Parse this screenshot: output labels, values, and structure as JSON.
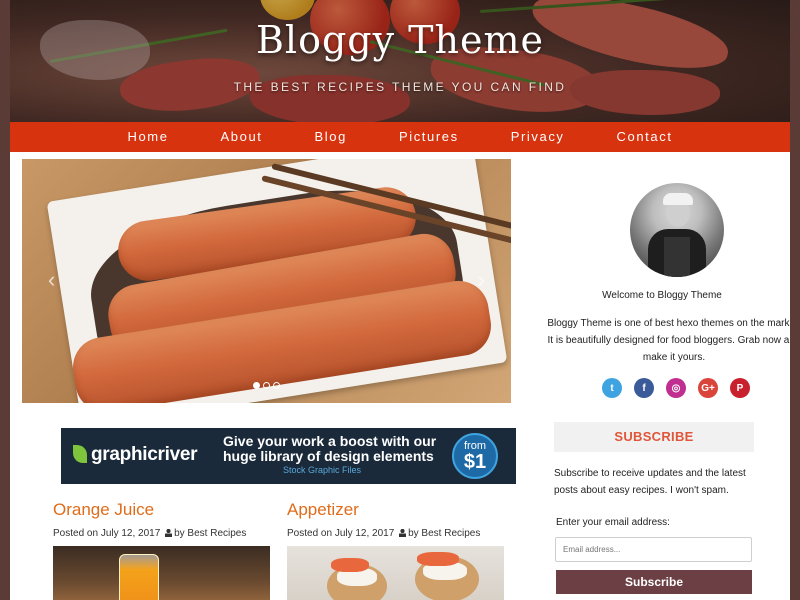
{
  "header": {
    "site_title": "Bloggy Theme",
    "tagline": "THE BEST RECIPES THEME YOU CAN FIND"
  },
  "nav": {
    "items": [
      "Home",
      "About",
      "Blog",
      "Pictures",
      "Privacy",
      "Contact"
    ]
  },
  "slider": {
    "prev_arrow": "‹",
    "next_arrow": "›",
    "dots": 3,
    "active_dot": 0
  },
  "ad_banner": {
    "logo": "graphicriver",
    "headline_line1": "Give your work a boost with our",
    "headline_line2": "huge library of design elements",
    "subline": "Stock Graphic Files",
    "badge_from": "from",
    "badge_price": "$1"
  },
  "posts": [
    {
      "title": "Orange Juice",
      "meta_prefix": "Posted on July 12, 2017",
      "meta_author": "by Best Recipes"
    },
    {
      "title": "Appetizer",
      "meta_prefix": "Posted on July 12, 2017",
      "meta_author": "by Best Recipes"
    }
  ],
  "sidebar": {
    "welcome": "Welcome to Bloggy Theme",
    "about": "Bloggy Theme is one of best hexo themes on the market. It is beautifully designed for food bloggers. Grab now and make it yours.",
    "socials": [
      {
        "name": "twitter-icon",
        "glyph": "t",
        "color": "#3ea3e0"
      },
      {
        "name": "facebook-icon",
        "glyph": "f",
        "color": "#3b5a9a"
      },
      {
        "name": "instagram-icon",
        "glyph": "◎",
        "color": "#c02f8f"
      },
      {
        "name": "google-plus-icon",
        "glyph": "G+",
        "color": "#d9453a"
      },
      {
        "name": "pinterest-icon",
        "glyph": "P",
        "color": "#c8202c"
      }
    ],
    "subscribe_heading": "SUBSCRIBE",
    "subscribe_text": "Subscribe to receive updates and the latest posts about easy recipes. I won't spam.",
    "email_label": "Enter your email address:",
    "email_placeholder": "Email address...",
    "subscribe_button": "Subscribe"
  },
  "colors": {
    "nav_bg": "#d8330f",
    "post_title": "#e06c1a",
    "subscribe_heading": "#e0563a",
    "subscribe_button": "#6b3f43"
  }
}
